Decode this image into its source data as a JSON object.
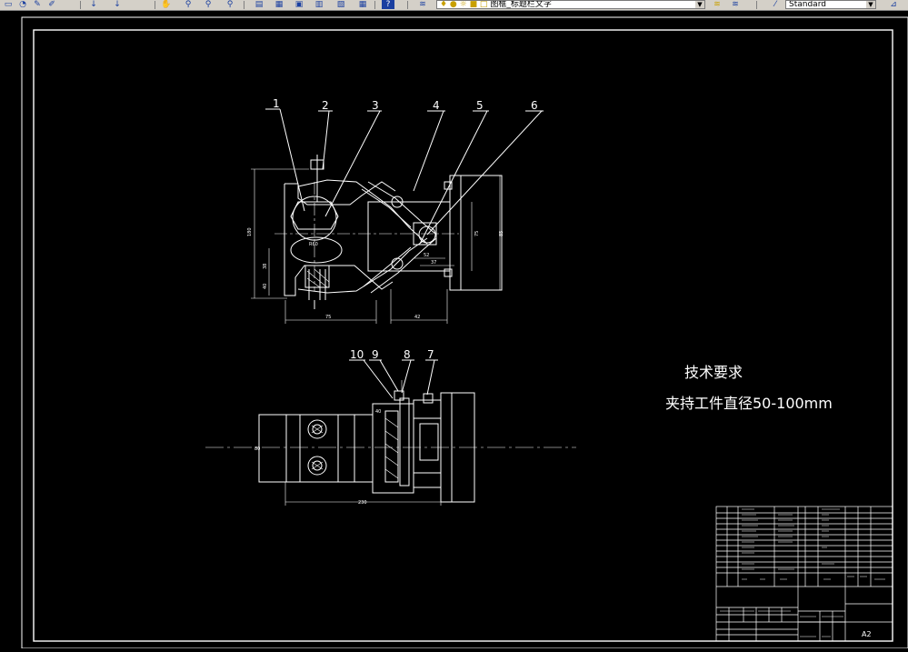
{
  "toolbar": {
    "layer_combo_value": "图框_标题栏文字",
    "text_style_value": "Standard",
    "icons": [
      "new-icon",
      "open-icon",
      "pan-icon",
      "match-properties-icon",
      "undo-icon",
      "redo-icon",
      "zoom-realtime-icon",
      "zoom-window-icon",
      "zoom-previous-icon",
      "properties-icon",
      "design-center-icon",
      "tool-palettes-icon",
      "sheet-set-icon",
      "markup-icon",
      "quickcalc-icon",
      "help-icon",
      "layer-manager-icon",
      "layer-previous-icon",
      "text-style-icon",
      "scale-icon"
    ]
  },
  "drawing": {
    "part_labels": [
      "1",
      "2",
      "3",
      "4",
      "5",
      "6",
      "10",
      "9",
      "8",
      "7"
    ],
    "dimensions": {
      "d_80": "80",
      "d_180": "180",
      "d_38": "38",
      "d_40": "40",
      "d_75": "75",
      "d_52": "52",
      "d_75b": "75",
      "d_42": "42",
      "d_37": "37",
      "d_85": "85",
      "d_230": "230",
      "d_40b": "40",
      "d_r60": "R60"
    },
    "tech_requirements_title": "技术要求",
    "tech_requirements_text": "夹持工件直径50-100mm",
    "title_block": {
      "sheet_size": "A2",
      "scale": "1:1",
      "material": "45"
    }
  }
}
